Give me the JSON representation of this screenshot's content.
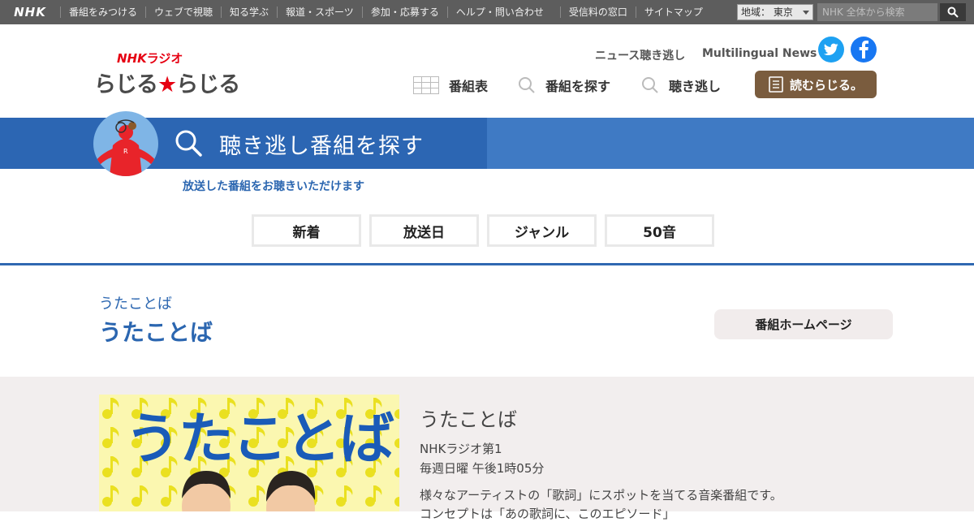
{
  "global_bar": {
    "logo": "NHK",
    "items": [
      "番組をみつける",
      "ウェブで視聴",
      "知る学ぶ",
      "報道・スポーツ",
      "参加・応募する",
      "ヘルプ・問い合わせ"
    ],
    "items_right": [
      "受信料の窓口",
      "サイトマップ"
    ],
    "region_label": "地域：",
    "region_value": "東京",
    "search_placeholder": "NHK 全体から検索"
  },
  "site_logo": {
    "top": "NHK",
    "top_suffix": "ラジオ",
    "main_left": "らじる",
    "main_star": "★",
    "main_right": "らじる"
  },
  "header_links": {
    "news": "ニュース聴き逃し",
    "multilingual": "Multilingual News"
  },
  "main_nav": {
    "schedule": "番組表",
    "find": "番組を探す",
    "ondemand": "聴き逃し",
    "yomu": "読むらじる。"
  },
  "banner": {
    "title": "聴き逃し番組を探す",
    "subtitle": "放送した番組をお聴きいただけます"
  },
  "tabs": [
    "新着",
    "放送日",
    "ジャンル",
    "50音"
  ],
  "program": {
    "kana": "うたことば",
    "title": "うたことば",
    "home_button": "番組ホームページ"
  },
  "detail": {
    "thumb_text": "うたことば",
    "title": "うたことば",
    "channel": "NHKラジオ第1",
    "schedule": "毎週日曜 午後1時05分",
    "description": "様々なアーティストの「歌詞」にスポットを当てる音楽番組です。",
    "description2": "コンセプトは「あの歌詞に、このエピソード」"
  },
  "colors": {
    "global_bar": "#5d5d5d",
    "banner": "#3f7ac4",
    "banner_dark": "#2c66b3",
    "brand_blue": "#2b66b0",
    "yomu_button": "#7a5c3e",
    "logo_red": "#e60012",
    "detail_bg": "#f2eeee"
  },
  "icons": [
    "search-icon",
    "grid-icon",
    "twitter-icon",
    "facebook-icon",
    "book-icon",
    "caret-down-icon"
  ]
}
